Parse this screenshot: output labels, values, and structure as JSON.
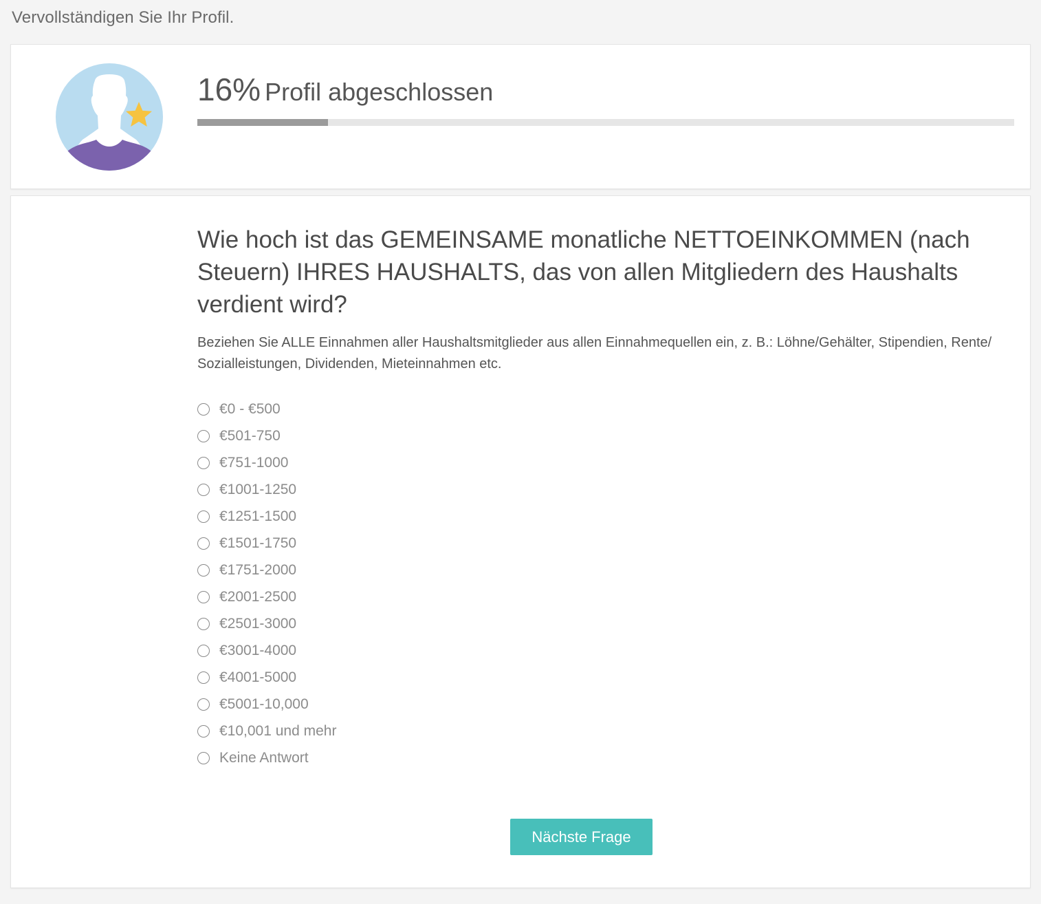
{
  "page": {
    "heading": "Vervollständigen Sie Ihr Profil."
  },
  "profile_progress": {
    "percent_text": "16%",
    "label": "Profil abgeschlossen",
    "progress_fraction": 0.16
  },
  "colors": {
    "page_background": "#f4f4f4",
    "avatar_circle": "#b9dcf0",
    "avatar_silhouette": "#ffffff",
    "avatar_shirt": "#7b62ad",
    "star": "#f6c340",
    "progress_fill": "#9b9b9b",
    "progress_track": "#e6e6e6",
    "button": "#48bfba"
  },
  "icons": {
    "avatar": "user-profile-star-icon"
  },
  "question": {
    "title": "Wie hoch ist das GEMEINSAME monatliche NETTOEINKOMMEN (nach Steuern) IHRES HAUSHALTS, das von allen Mitgliedern des Haushalts verdient wird?",
    "hint": "Beziehen Sie ALLE Einnahmen aller Haushaltsmitglieder aus allen Einnahmequellen ein, z. B.: Löhne/Gehälter, Stipendien, Rente/ Sozialleistungen, Dividenden, Mieteinnahmen etc.",
    "options": [
      "€0 - €500",
      "€501-750",
      "€751-1000",
      "€1001-1250",
      "€1251-1500",
      "€1501-1750",
      "€1751-2000",
      "€2001-2500",
      "€2501-3000",
      "€3001-4000",
      "€4001-5000",
      "€5001-10,000",
      "€10,001 und mehr",
      "Keine Antwort"
    ],
    "selected": null
  },
  "actions": {
    "next_label": "Nächste Frage"
  }
}
